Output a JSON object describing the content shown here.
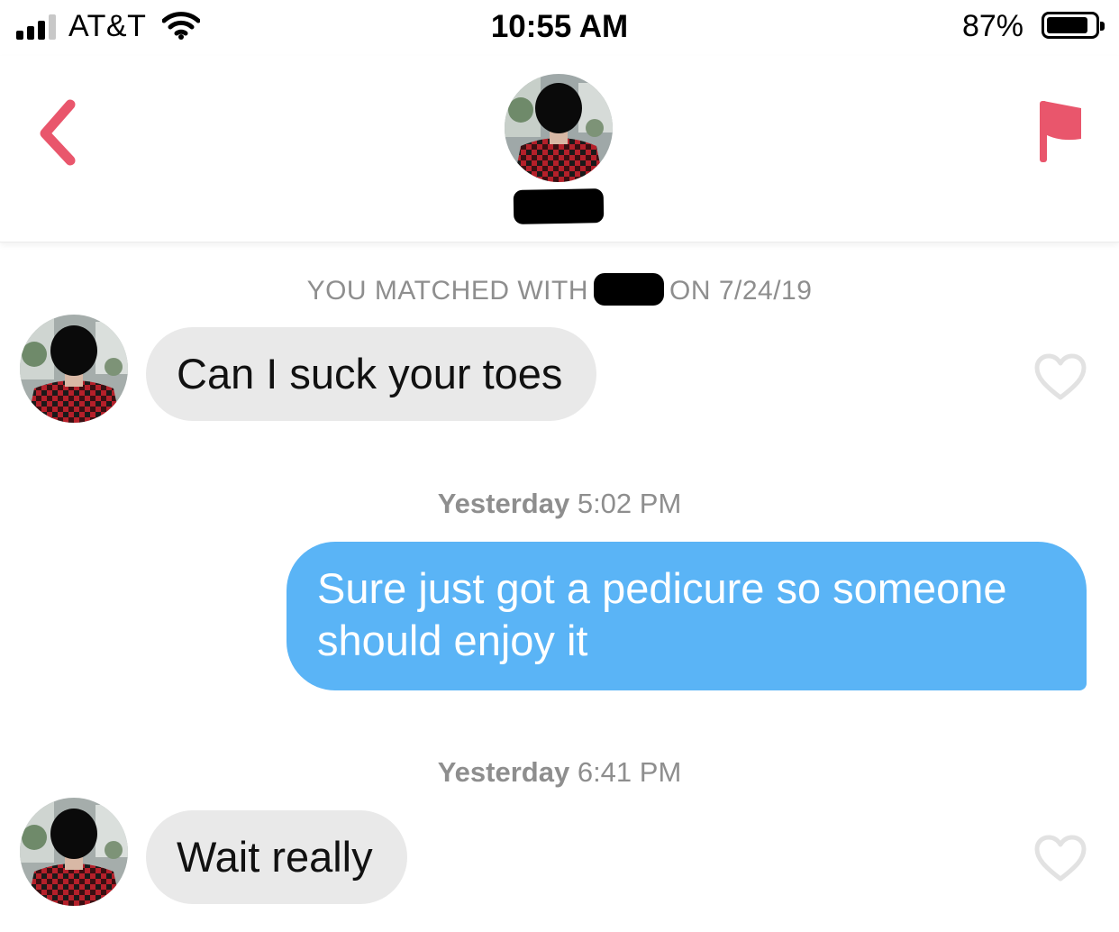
{
  "status_bar": {
    "carrier": "AT&T",
    "time": "10:55 AM",
    "battery_percent": "87%",
    "battery_level": 0.87,
    "signal_bars_active": 3,
    "signal_bars_total": 4
  },
  "header": {
    "back_icon": "chevron-left-icon",
    "report_icon": "flag-icon",
    "accent_color": "#e9566c"
  },
  "chat": {
    "match_prefix": "YOU MATCHED WITH",
    "match_suffix": "ON 7/24/19",
    "messages": [
      {
        "direction": "incoming",
        "text": "Can I suck your toes"
      },
      {
        "direction": "outgoing",
        "line1": "Sure just got a pedicure so someone",
        "line2": "should enjoy it"
      },
      {
        "direction": "incoming",
        "text": "Wait really"
      }
    ],
    "timestamps": [
      {
        "day": "Yesterday",
        "time": "5:02 PM"
      },
      {
        "day": "Yesterday",
        "time": "6:41 PM"
      }
    ],
    "colors": {
      "incoming_bubble": "#e9e9e9",
      "outgoing_bubble": "#5ab4f6",
      "meta_text": "#8e8e8e"
    }
  }
}
